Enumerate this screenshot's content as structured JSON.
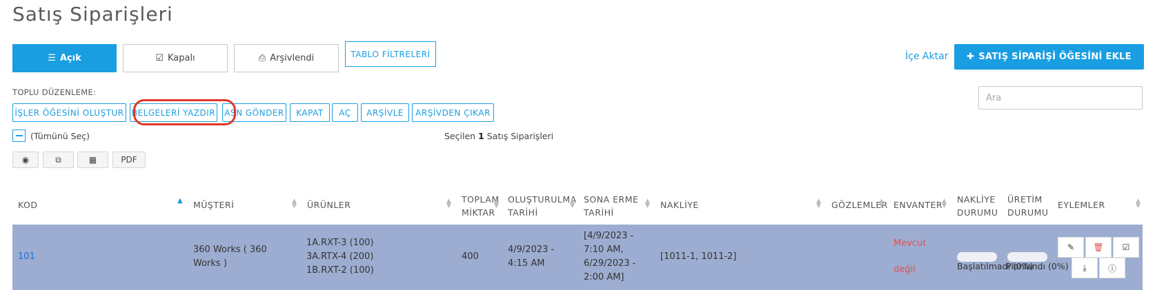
{
  "page": {
    "title": "Satış Siparişleri"
  },
  "tabs": [
    {
      "label": "Açık",
      "icon": "list-icon",
      "active": true
    },
    {
      "label": "Kapalı",
      "icon": "check-square-icon",
      "active": false
    },
    {
      "label": "Arşivlendi",
      "icon": "inbox-icon",
      "active": false
    }
  ],
  "table_filters_label": "TABLO FİLTRELERİ",
  "import_label": "İçe Aktar",
  "add_button_label": "SATIŞ SİPARİŞİ ÖĞESİNİ EKLE",
  "bulk": {
    "label": "TOPLU DÜZENLEME:",
    "buttons": [
      "İŞLER ÖĞESİNİ OLUŞTUR",
      "BELGELERİ YAZDIR",
      "ASN GÖNDER",
      "KAPAT",
      "AÇ",
      "ARŞİVLE",
      "ARŞİVDEN ÇIKAR"
    ]
  },
  "search": {
    "placeholder": "Ara"
  },
  "select_all_label": "(Tümünü Seç)",
  "selection": {
    "prefix": "Seçilen",
    "count": "1",
    "suffix": "Satış Siparişleri"
  },
  "view_buttons": [
    {
      "icon": "eye-icon"
    },
    {
      "icon": "copy-icon"
    },
    {
      "icon": "table-icon"
    },
    {
      "label": "PDF"
    }
  ],
  "columns": [
    "KOD",
    "MÜŞTERİ",
    "ÜRÜNLER",
    "TOPLAM MİKTAR",
    "OLUŞTURULMA TARİHİ",
    "SONA ERME TARİHİ",
    "NAKLİYE",
    "GÖZLEMLER",
    "ENVANTER",
    "NAKLİYE DURUMU",
    "ÜRETİM DURUMU",
    "EYLEMLER"
  ],
  "column_lines": {
    "toplam": [
      "TOPLAM",
      "MİKTAR"
    ],
    "olusturulma": [
      "OLUŞTURULMA",
      "TARİHİ"
    ],
    "sona": [
      "SONA ERME",
      "TARİHİ"
    ],
    "nakliye_durumu": [
      "NAKLİYE",
      "DURUMU"
    ],
    "uretim_durumu": [
      "ÜRETİM",
      "DURUMU"
    ]
  },
  "row": {
    "code": "101",
    "customer": "360 Works ( 360 Works )",
    "products": [
      "1A.RXT-3 (100)",
      "3A.RTX-4 (200)",
      "1B.RXT-2 (100)"
    ],
    "total_qty": "400",
    "created": "4/9/2023 - 4:15 AM",
    "expiry": [
      "[4/9/2023 -",
      "7:10 AM,",
      "6/29/2023 -",
      "2:00 AM]"
    ],
    "shipping": "[1011-1, 1011-2]",
    "observations": "",
    "inventory": [
      "Mevcut",
      "değil"
    ],
    "shipping_status": "Başlatılmadı (0%)",
    "production_status": "Planlandı (0%)",
    "actions": [
      "edit-icon",
      "trash-icon",
      "check-square-icon",
      "download-icon",
      "info-icon"
    ]
  },
  "colors": {
    "accent": "#1a9ee2",
    "row_highlight": "#9dadd1",
    "ring": "#e0362a",
    "danger": "#e05050"
  }
}
